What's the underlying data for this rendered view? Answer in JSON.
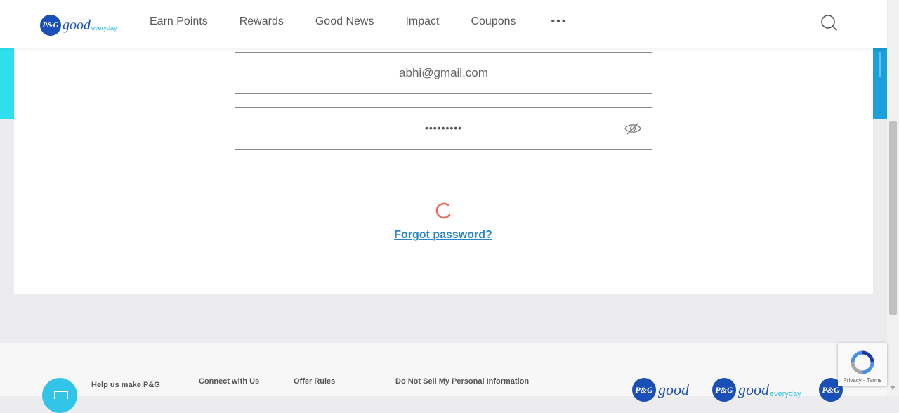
{
  "header": {
    "logo_badge": "P&G",
    "logo_good": "good",
    "logo_everyday": "everyday",
    "nav": [
      "Earn Points",
      "Rewards",
      "Good News",
      "Impact",
      "Coupons"
    ],
    "more_label": "•••",
    "search_icon": "search-icon"
  },
  "form": {
    "email_value": "abhi@gmail.com",
    "password_masked": "•••••••••",
    "forgot_label": "Forgot password?",
    "spinner_color": "#f06a5c"
  },
  "footer": {
    "help_label": "Help us make P&G",
    "connect_label": "Connect with Us",
    "offer_label": "Offer Rules",
    "donotsell_label": "Do Not Sell My Personal Information",
    "brand_badge": "P&G",
    "brand_good": "good",
    "brand_everyday": "everyday"
  },
  "recaptcha": {
    "text": "Privacy - Terms"
  },
  "colors": {
    "accent_cyan": "#2ee0ee",
    "accent_blue": "#1aa0db",
    "brand_blue": "#1a4fb5",
    "link_blue": "#2a86c4"
  }
}
